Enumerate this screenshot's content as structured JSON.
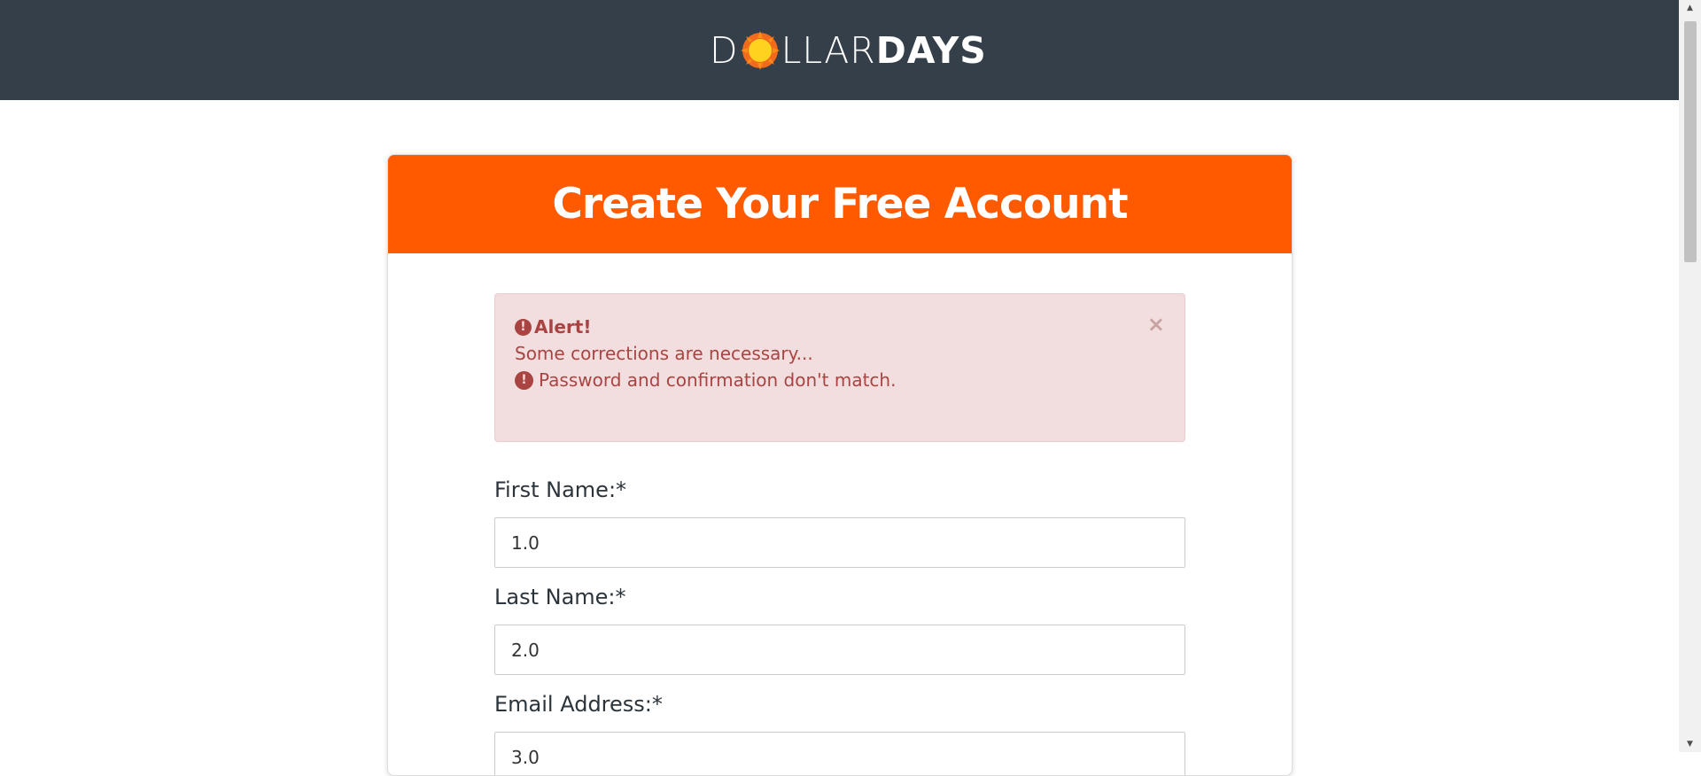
{
  "header": {
    "logo_light_left": "D",
    "logo_light_right": "LLAR",
    "logo_bold": "DAYS",
    "logo_icon": "sun-icon",
    "background": "#343f49"
  },
  "card": {
    "title": "Create Your Free Account",
    "header_color": "#ff5a00"
  },
  "alert": {
    "title": "Alert!",
    "message": "Some corrections are necessary...",
    "errors": [
      "Password and confirmation don't match."
    ],
    "close_icon": "close-icon",
    "close_glyph": "×",
    "icon": "exclamation-circle-icon",
    "glyph": "!"
  },
  "form": {
    "first_name": {
      "label": "First Name:*",
      "value": "1.0"
    },
    "last_name": {
      "label": "Last Name:*",
      "value": "2.0"
    },
    "email": {
      "label": "Email Address:*",
      "value": "3.0"
    }
  },
  "scrollbar": {
    "up_glyph": "▲",
    "down_glyph": "▼"
  }
}
